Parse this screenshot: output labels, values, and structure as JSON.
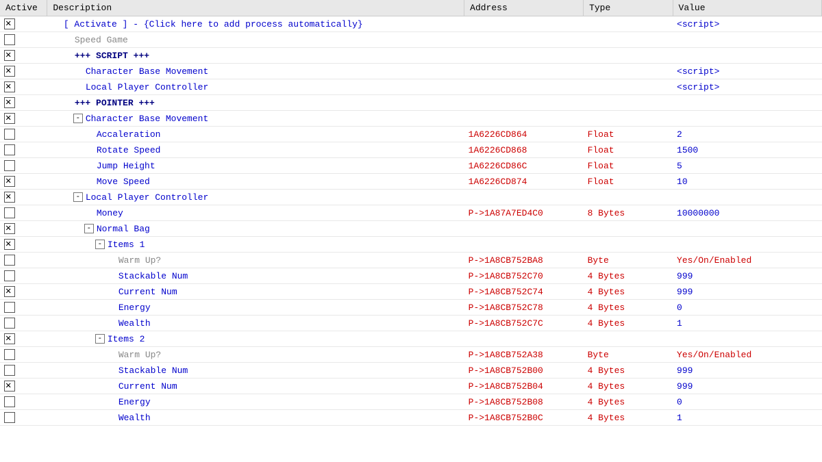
{
  "header": {
    "col_active": "Active",
    "col_description": "Description",
    "col_address": "Address",
    "col_type": "Type",
    "col_value": "Value"
  },
  "rows": [
    {
      "id": "row-activate",
      "indent": 0,
      "active_checked": true,
      "expand": null,
      "desc": "[ Activate ] - {Click here to add process automatically}",
      "desc_class": "desc-blue",
      "address": "",
      "type": "",
      "value": "<script>",
      "value_class": "val-blue"
    },
    {
      "id": "row-speed-game",
      "indent": 1,
      "active_checked": false,
      "expand": null,
      "desc": "Speed Game",
      "desc_class": "desc-gray",
      "address": "",
      "type": "",
      "value": "",
      "value_class": ""
    },
    {
      "id": "row-script-header",
      "indent": 1,
      "active_checked": true,
      "expand": null,
      "desc": "+++ SCRIPT +++",
      "desc_class": "desc-dark-blue",
      "address": "",
      "type": "",
      "value": "",
      "value_class": ""
    },
    {
      "id": "row-char-base-script",
      "indent": 2,
      "active_checked": true,
      "expand": null,
      "desc": "Character Base Movement",
      "desc_class": "desc-blue",
      "address": "",
      "type": "",
      "value": "<script>",
      "value_class": "val-blue"
    },
    {
      "id": "row-local-player-script",
      "indent": 2,
      "active_checked": true,
      "expand": null,
      "desc": "Local Player Controller",
      "desc_class": "desc-blue",
      "address": "",
      "type": "",
      "value": "<script>",
      "value_class": "val-blue"
    },
    {
      "id": "row-pointer-header",
      "indent": 1,
      "active_checked": true,
      "expand": null,
      "desc": "+++ POINTER +++",
      "desc_class": "desc-dark-blue",
      "address": "",
      "type": "",
      "value": "",
      "value_class": ""
    },
    {
      "id": "row-char-base-ptr",
      "indent": 2,
      "active_checked": true,
      "expand": "minus",
      "desc": "Character Base Movement",
      "desc_class": "desc-blue",
      "address": "",
      "type": "",
      "value": "",
      "value_class": ""
    },
    {
      "id": "row-acceleration",
      "indent": 3,
      "active_checked": false,
      "expand": null,
      "desc": "Accaleration",
      "desc_class": "desc-blue",
      "address": "1A6226CD864",
      "type": "Float",
      "value": "2",
      "value_class": "val-blue"
    },
    {
      "id": "row-rotate-speed",
      "indent": 3,
      "active_checked": false,
      "expand": null,
      "desc": "Rotate Speed",
      "desc_class": "desc-blue",
      "address": "1A6226CD868",
      "type": "Float",
      "value": "1500",
      "value_class": "val-blue"
    },
    {
      "id": "row-jump-height",
      "indent": 3,
      "active_checked": false,
      "expand": null,
      "desc": "Jump Height",
      "desc_class": "desc-blue",
      "address": "1A6226CD86C",
      "type": "Float",
      "value": "5",
      "value_class": "val-blue"
    },
    {
      "id": "row-move-speed",
      "indent": 3,
      "active_checked": true,
      "expand": null,
      "desc": "Move Speed",
      "desc_class": "desc-blue",
      "address": "1A6226CD874",
      "type": "Float",
      "value": "10",
      "value_class": "val-blue"
    },
    {
      "id": "row-local-player-ptr",
      "indent": 2,
      "active_checked": true,
      "expand": "minus",
      "desc": "Local Player Controller",
      "desc_class": "desc-blue",
      "address": "",
      "type": "",
      "value": "",
      "value_class": ""
    },
    {
      "id": "row-money",
      "indent": 3,
      "active_checked": false,
      "expand": null,
      "desc": "Money",
      "desc_class": "desc-blue",
      "address": "P->1A87A7ED4C0",
      "type": "8 Bytes",
      "value": "10000000",
      "value_class": "val-blue"
    },
    {
      "id": "row-normal-bag",
      "indent": 3,
      "active_checked": true,
      "expand": "minus",
      "desc": "Normal Bag",
      "desc_class": "desc-blue",
      "address": "",
      "type": "",
      "value": "",
      "value_class": ""
    },
    {
      "id": "row-items1",
      "indent": 4,
      "active_checked": true,
      "expand": "minus",
      "desc": "Items 1",
      "desc_class": "desc-blue",
      "address": "",
      "type": "",
      "value": "",
      "value_class": ""
    },
    {
      "id": "row-warmup1",
      "indent": 5,
      "active_checked": false,
      "expand": null,
      "desc": "Warm Up?",
      "desc_class": "desc-gray",
      "address": "P->1A8CB752BA8",
      "type": "Byte",
      "value": "Yes/On/Enabled",
      "value_class": "val-red"
    },
    {
      "id": "row-stackable1",
      "indent": 5,
      "active_checked": false,
      "expand": null,
      "desc": "Stackable Num",
      "desc_class": "desc-blue",
      "address": "P->1A8CB752C70",
      "type": "4 Bytes",
      "value": "999",
      "value_class": "val-blue"
    },
    {
      "id": "row-current1",
      "indent": 5,
      "active_checked": true,
      "expand": null,
      "desc": "Current Num",
      "desc_class": "desc-blue",
      "address": "P->1A8CB752C74",
      "type": "4 Bytes",
      "value": "999",
      "value_class": "val-blue"
    },
    {
      "id": "row-energy1",
      "indent": 5,
      "active_checked": false,
      "expand": null,
      "desc": "Energy",
      "desc_class": "desc-blue",
      "address": "P->1A8CB752C78",
      "type": "4 Bytes",
      "value": "0",
      "value_class": "val-blue"
    },
    {
      "id": "row-wealth1",
      "indent": 5,
      "active_checked": false,
      "expand": null,
      "desc": "Wealth",
      "desc_class": "desc-blue",
      "address": "P->1A8CB752C7C",
      "type": "4 Bytes",
      "value": "1",
      "value_class": "val-blue"
    },
    {
      "id": "row-items2",
      "indent": 4,
      "active_checked": true,
      "expand": "minus",
      "desc": "Items 2",
      "desc_class": "desc-blue",
      "address": "",
      "type": "",
      "value": "",
      "value_class": ""
    },
    {
      "id": "row-warmup2",
      "indent": 5,
      "active_checked": false,
      "expand": null,
      "desc": "Warm Up?",
      "desc_class": "desc-gray",
      "address": "P->1A8CB752A38",
      "type": "Byte",
      "value": "Yes/On/Enabled",
      "value_class": "val-red"
    },
    {
      "id": "row-stackable2",
      "indent": 5,
      "active_checked": false,
      "expand": null,
      "desc": "Stackable Num",
      "desc_class": "desc-blue",
      "address": "P->1A8CB752B00",
      "type": "4 Bytes",
      "value": "999",
      "value_class": "val-blue"
    },
    {
      "id": "row-current2",
      "indent": 5,
      "active_checked": true,
      "expand": null,
      "desc": "Current Num",
      "desc_class": "desc-blue",
      "address": "P->1A8CB752B04",
      "type": "4 Bytes",
      "value": "999",
      "value_class": "val-blue"
    },
    {
      "id": "row-energy2",
      "indent": 5,
      "active_checked": false,
      "expand": null,
      "desc": "Energy",
      "desc_class": "desc-blue",
      "address": "P->1A8CB752B08",
      "type": "4 Bytes",
      "value": "0",
      "value_class": "val-blue"
    },
    {
      "id": "row-wealth2",
      "indent": 5,
      "active_checked": false,
      "expand": null,
      "desc": "Wealth",
      "desc_class": "desc-blue",
      "address": "P->1A8CB752B0C",
      "type": "4 Bytes",
      "value": "1",
      "value_class": "val-blue"
    }
  ]
}
